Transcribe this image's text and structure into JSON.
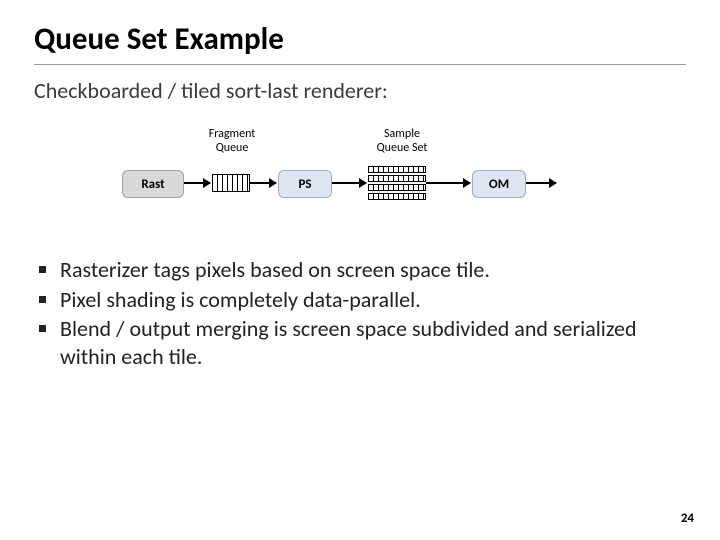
{
  "title": "Queue Set Example",
  "subtitle": "Checkboarded / tiled sort-last renderer:",
  "diagram": {
    "frag_label": "Fragment\nQueue",
    "sample_label": "Sample\nQueue Set",
    "rast": "Rast",
    "ps": "PS",
    "om": "OM"
  },
  "bullets": [
    "Rasterizer tags pixels based on screen space tile.",
    "Pixel shading is completely data-parallel.",
    "Blend / output merging is screen space subdivided and serialized within each tile."
  ],
  "page": "24"
}
